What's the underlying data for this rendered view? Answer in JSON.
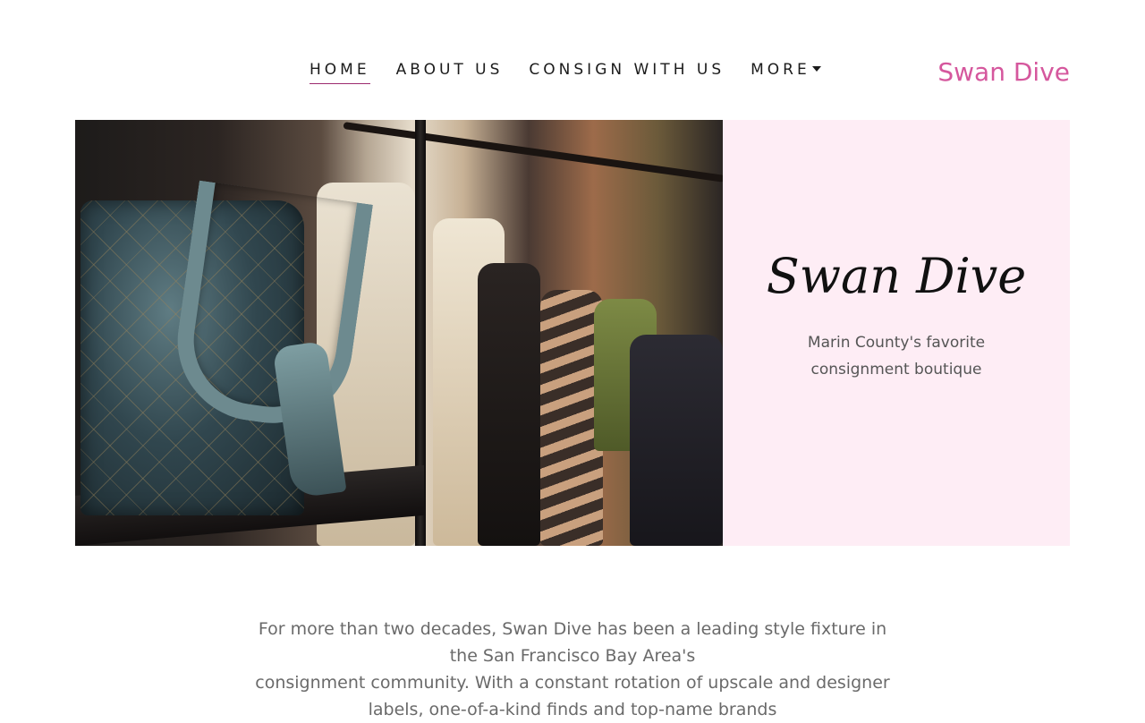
{
  "nav": {
    "items": [
      {
        "label": "HOME",
        "active": true
      },
      {
        "label": "ABOUT US",
        "active": false
      },
      {
        "label": "CONSIGN WITH US",
        "active": false
      },
      {
        "label": "MORE",
        "active": false,
        "has_dropdown": true
      }
    ],
    "brand": "Swan Dive",
    "dropdown_icon": "caret-down-icon"
  },
  "hero": {
    "image_description_name": "handbag-and-clothing-rack-photo",
    "title": "Swan Dive",
    "subtitle": "Marin County's favorite consignment boutique"
  },
  "intro": {
    "line1": "For more than two decades, Swan Dive has been a leading style fixture in the San Francisco Bay Area's",
    "line2": "consignment community. With a constant rotation of upscale and designer labels, one-of-a-kind finds and top-name brands"
  },
  "colors": {
    "brand_pink": "#d5579d",
    "hero_panel_bg": "#feedf5",
    "active_underline": "#9c2b6f"
  }
}
